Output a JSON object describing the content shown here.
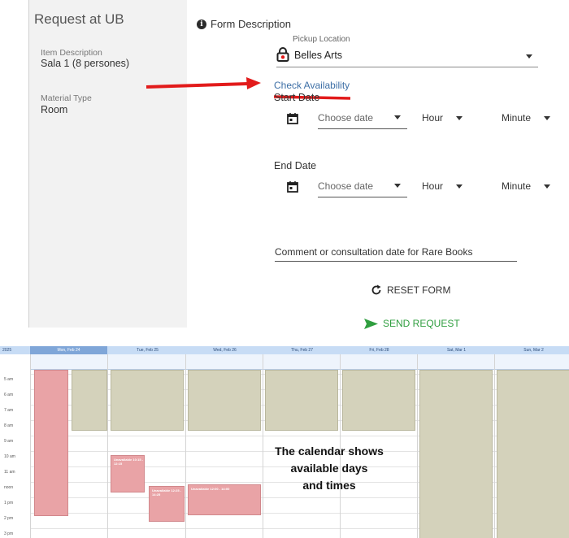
{
  "left_panel": {
    "title": "Request at UB",
    "item_description_label": "Item Description",
    "item_description_value": "Sala 1 (8 persones)",
    "material_type_label": "Material Type",
    "material_type_value": "Room"
  },
  "form": {
    "section_title": "Form Description",
    "pickup_label": "Pickup Location",
    "pickup_value": "Belles Arts",
    "check_availability": "Check Availability",
    "start_date_label": "Start Date",
    "end_date_label": "End Date",
    "date_placeholder": "Choose date",
    "hour_label": "Hour",
    "minute_label": "Minute",
    "comment_label": "Comment or consultation date for Rare Books",
    "reset_label": "RESET FORM",
    "send_label": "SEND REQUEST"
  },
  "colors": {
    "accent_link": "#3d6fa6",
    "send_green": "#2f9e3f",
    "arrow_red": "#e21b1b",
    "available_beige": "#d4d2bb",
    "unavailable_pink": "#e9a3a6"
  },
  "calendar": {
    "year": "2025",
    "days": [
      "Mon, Feb 24",
      "Tue, Feb 25",
      "Wed, Feb 26",
      "Thu, Feb 27",
      "Fri, Feb 28",
      "Sat, Mar 1",
      "Sun, Mar 2"
    ],
    "active_day": "Mon, Feb 24",
    "hours": [
      "5 am",
      "6 am",
      "7 am",
      "8 am",
      "9 am",
      "10 am",
      "11 am",
      "noon",
      "1 pm",
      "2 pm",
      "3 pm"
    ],
    "unavailable_tue": "Unavailable 10:15 - 12:15",
    "unavailable_wed_a": "Unavailable 12:25 - 14:25",
    "unavailable_wed_b": "Unavailable 12:00 - 14:00"
  },
  "callout": {
    "line1": "The calendar shows",
    "line2": "available days",
    "line3": "and times"
  }
}
